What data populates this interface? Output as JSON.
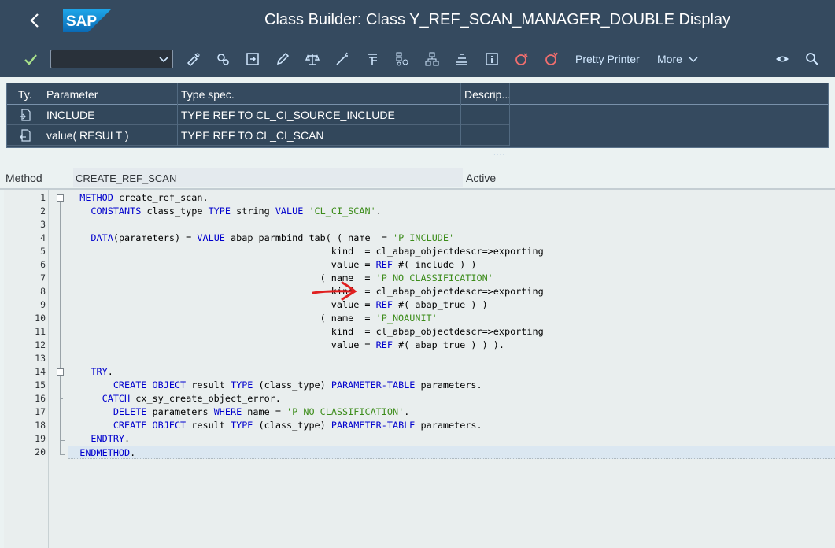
{
  "titlebar": {
    "logo_text": "SAP",
    "title": "Class Builder: Class Y_REF_SCAN_MANAGER_DOUBLE Display"
  },
  "toolbar": {
    "okcode_value": "",
    "pretty_printer": "Pretty Printer",
    "more": "More",
    "icons": [
      "enter-icon",
      "other-object-icon",
      "display-change-icon",
      "active-inactive-icon",
      "edit-icon",
      "check-icon",
      "activate-icon",
      "where-used-icon",
      "object-list-icon",
      "hierarchy-icon",
      "stack-icon",
      "info-icon",
      "breakpoint-icon",
      "session-breakpoint-icon",
      "view-icon",
      "search-icon"
    ]
  },
  "params": {
    "headers": [
      "Ty.",
      "Parameter",
      "Type spec.",
      "Descrip..."
    ],
    "rows": [
      {
        "parameter": "INCLUDE",
        "type_spec": "TYPE REF TO CL_CI_SOURCE_INCLUDE",
        "description": ""
      },
      {
        "parameter": "value( RESULT )",
        "type_spec": "TYPE REF TO CL_CI_SCAN",
        "description": ""
      }
    ]
  },
  "method": {
    "label": "Method",
    "name": "CREATE_REF_SCAN",
    "status": "Active"
  },
  "code": {
    "line_numbers": [
      "1",
      "2",
      "3",
      "4",
      "5",
      "6",
      "7",
      "8",
      "9",
      "10",
      "11",
      "12",
      "13",
      "14",
      "15",
      "16",
      "17",
      "18",
      "19",
      "20"
    ]
  },
  "colors": {
    "shell": "#354a5f",
    "keyword": "#0000cd",
    "string": "#3c8c1a",
    "annotation_arrow": "#e02020"
  }
}
